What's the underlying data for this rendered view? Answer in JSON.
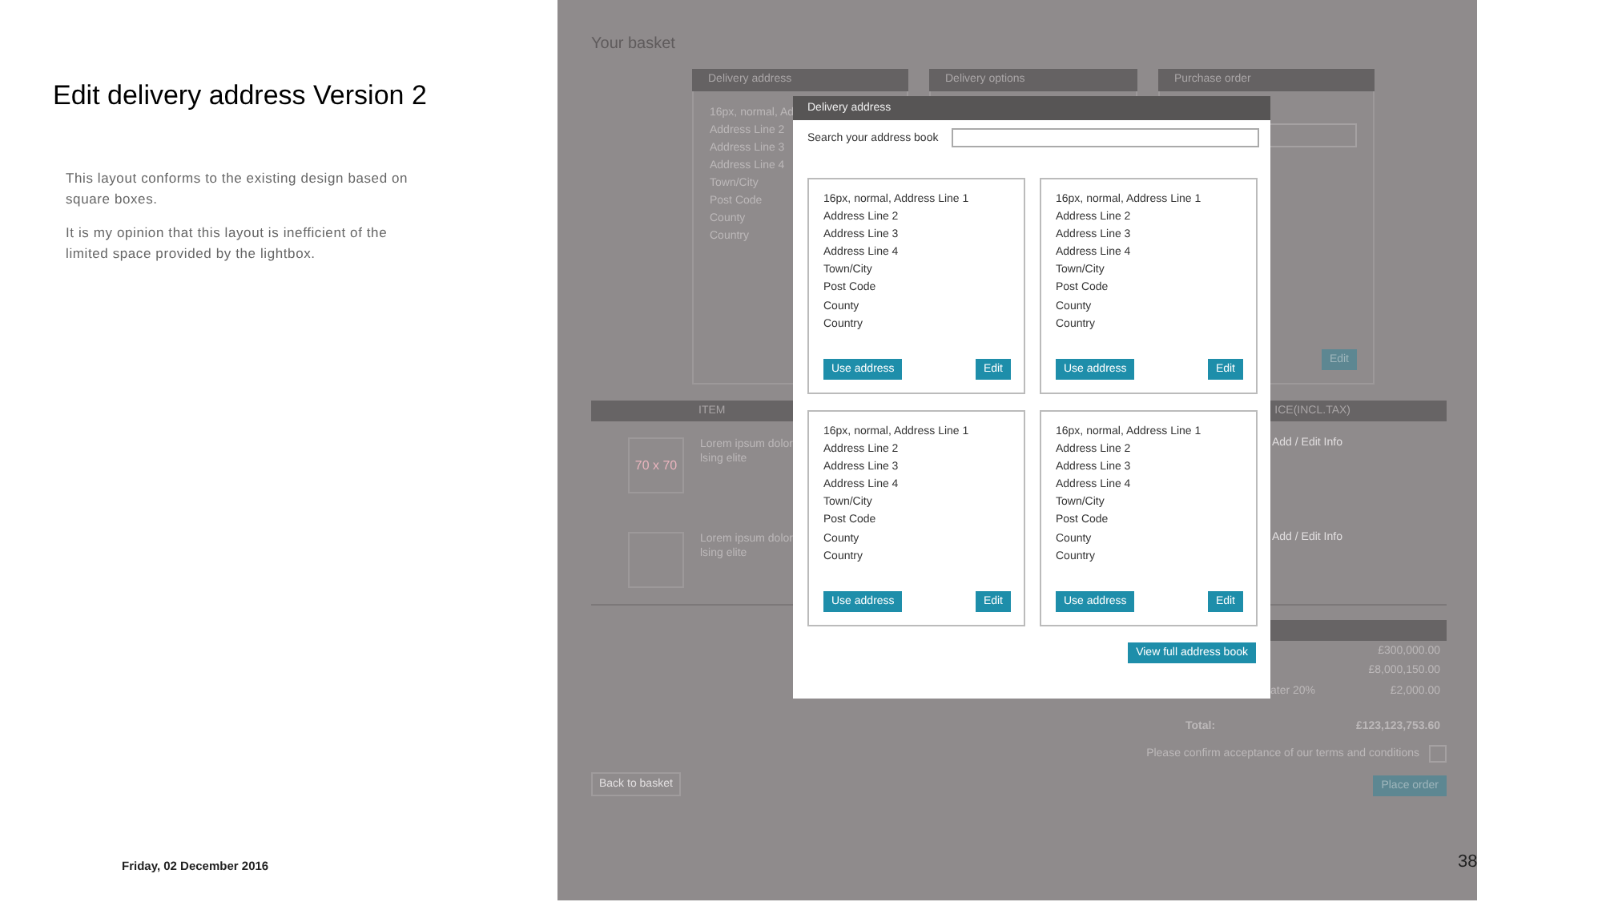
{
  "slide": {
    "title": "Edit delivery address Version 2",
    "notes": [
      "This layout conforms to the existing design based on square boxes.",
      "It is my opinion that this layout is inefficient of the limited space provided by the lightbox."
    ],
    "date": "Friday, 02 December 2016",
    "page_number": "38"
  },
  "page": {
    "title": "Your basket",
    "panels": [
      {
        "title": "Delivery address",
        "lines": [
          "16px, normal, Ad",
          "Address Line 2",
          "Address Line 3",
          "Address Line 4",
          "Town/City",
          "Post Code",
          "County",
          "Country"
        ]
      },
      {
        "title": "Delivery options"
      },
      {
        "title": "Purchase order",
        "edit_button": "Edit"
      }
    ],
    "table": {
      "columns": [
        "ITEM",
        "ICE(INCL.TAX)"
      ],
      "rows": [
        {
          "image_label": "70 x 70",
          "description": [
            "Lorem ipsum dolor",
            "lsing elite"
          ],
          "link": "Add / Edit Info"
        },
        {
          "description": [
            "Lorem ipsum dolor",
            "lsing elite"
          ],
          "link": "Add / Edit Info"
        }
      ]
    },
    "summary": {
      "rows": [
        {
          "value": "£300,000.00"
        },
        {
          "value": "£8,000,150.00"
        },
        {
          "label": "ater 20%",
          "value": "£2,000.00"
        }
      ],
      "total_label": "Total:",
      "total_value": "£123,123,753.60"
    },
    "terms": {
      "text": "Please confirm acceptance of our terms and conditions",
      "checked": false
    },
    "back_button": "Back to basket",
    "place_order_button": "Place order"
  },
  "modal": {
    "title": "Delivery address",
    "search_label": "Search your address book",
    "cards": [
      {
        "lines": [
          "16px, normal, Address Line 1",
          "Address Line 2",
          "Address Line 3",
          "Address Line 4",
          "Town/City",
          "Post Code",
          "County",
          "Country"
        ],
        "use_button": "Use address",
        "edit_button": "Edit"
      },
      {
        "lines": [
          "16px, normal, Address Line 1",
          "Address Line 2",
          "Address Line 3",
          "Address Line 4",
          "Town/City",
          "Post Code",
          "County",
          "Country"
        ],
        "use_button": "Use address",
        "edit_button": "Edit"
      },
      {
        "lines": [
          "16px, normal, Address Line 1",
          "Address Line 2",
          "Address Line 3",
          "Address Line 4",
          "Town/City",
          "Post Code",
          "County",
          "Country"
        ],
        "use_button": "Use address",
        "edit_button": "Edit"
      },
      {
        "lines": [
          "16px, normal, Address Line 1",
          "Address Line 2",
          "Address Line 3",
          "Address Line 4",
          "Town/City",
          "Post Code",
          "County",
          "Country"
        ],
        "use_button": "Use address",
        "edit_button": "Edit"
      }
    ],
    "view_all_button": "View full address book"
  }
}
